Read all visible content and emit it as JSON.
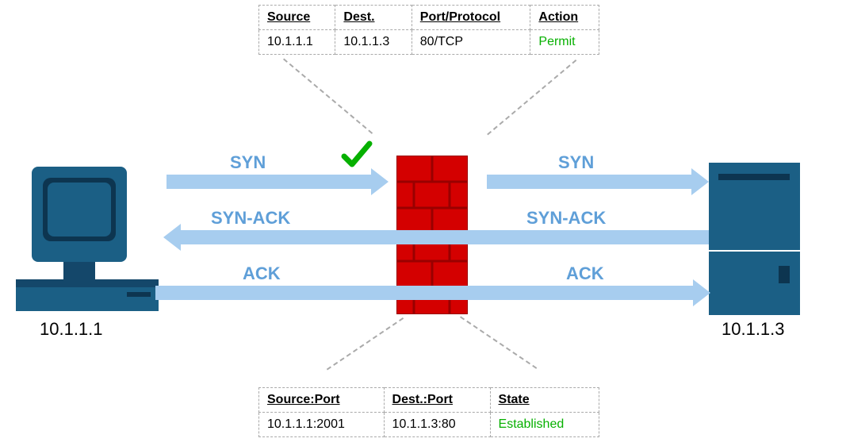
{
  "acl": {
    "headers": {
      "source": "Source",
      "dest": "Dest.",
      "port": "Port/Protocol",
      "action": "Action"
    },
    "row": {
      "source": "10.1.1.1",
      "dest": "10.1.1.3",
      "port": "80/TCP",
      "action": "Permit"
    }
  },
  "state": {
    "headers": {
      "srcport": "Source:Port",
      "dstport": "Dest.:Port",
      "state": "State"
    },
    "row": {
      "srcport": "10.1.1.1:2001",
      "dstport": "10.1.1.3:80",
      "state": "Established"
    }
  },
  "client_ip": "10.1.1.1",
  "server_ip": "10.1.1.3",
  "labels": {
    "syn_l": "SYN",
    "syn_r": "SYN",
    "synack_l": "SYN-ACK",
    "synack_r": "SYN-ACK",
    "ack_l": "ACK",
    "ack_r": "ACK"
  },
  "check": "✔"
}
